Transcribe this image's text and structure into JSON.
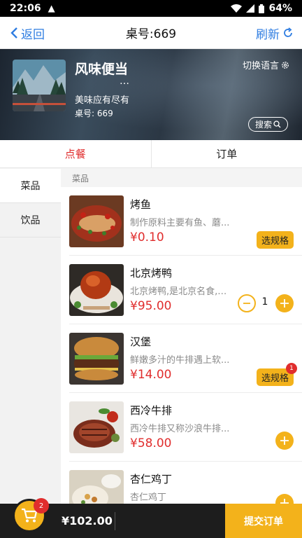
{
  "status_bar": {
    "time": "22:06",
    "battery": "64%"
  },
  "nav": {
    "back_label": "返回",
    "title": "桌号:669",
    "refresh_label": "刷新"
  },
  "shop": {
    "name": "风味便当",
    "more": "…",
    "slogan": "美味应有尽有",
    "table": "桌号: 669",
    "lang_switch": "切换语言",
    "search_label": "搜索"
  },
  "tabs": [
    {
      "label": "点餐",
      "active": true
    },
    {
      "label": "订单",
      "active": false
    }
  ],
  "sidebar": {
    "items": [
      {
        "label": "菜品"
      },
      {
        "label": "饮品"
      }
    ]
  },
  "section": {
    "title": "菜品"
  },
  "dishes": [
    {
      "name": "烤鱼",
      "desc": "制作原料主要有鱼、蘑...",
      "price": "¥0.10",
      "action": "选规格"
    },
    {
      "name": "北京烤鸭",
      "desc": "北京烤鸭,是北京名食,它...",
      "price": "¥95.00",
      "qty": "1"
    },
    {
      "name": "汉堡",
      "desc": "鲜嫩多汁的牛排遇上软...",
      "price": "¥14.00",
      "action": "选规格",
      "badge": "1"
    },
    {
      "name": "西冷牛排",
      "desc": "西冷牛排又称沙浪牛排...",
      "price": "¥58.00"
    },
    {
      "name": "杏仁鸡丁",
      "desc": "杏仁鸡丁",
      "price": ""
    }
  ],
  "cart": {
    "count": "2",
    "total": "¥102.00",
    "submit_label": "提交订单"
  },
  "colors": {
    "accent_blue": "#2f7de1",
    "price_red": "#e02d2d",
    "yellow": "#f3b21b",
    "dark": "#1d1d1d"
  }
}
